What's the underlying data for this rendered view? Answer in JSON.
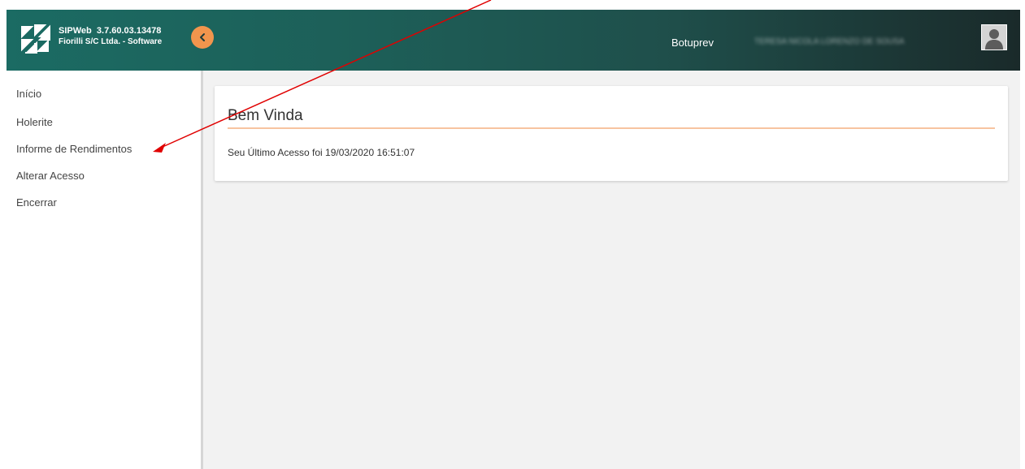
{
  "header": {
    "app_name": "SIPWeb",
    "version": "3.7.60.03.13478",
    "company": "Fiorilli S/C Ltda. - Software",
    "org_name": "Botuprev",
    "user_name_obscured": "TERESA NICOLA LORENZO DE SOUSA",
    "collapse_icon": "chevron-left-icon",
    "logo_icon": "fiorilli-logo-icon",
    "avatar_icon": "user-silhouette-icon",
    "accent_color": "#f2954d",
    "header_color_start": "#1b6b63",
    "header_color_end": "#1a2a2a"
  },
  "sidebar": {
    "items": [
      {
        "label": "Início"
      },
      {
        "label": "Holerite"
      },
      {
        "label": "Informe de Rendimentos"
      },
      {
        "label": "Alterar Acesso"
      },
      {
        "label": "Encerrar"
      }
    ]
  },
  "main": {
    "card_title": "Bem Vinda",
    "last_access": "Seu Último Acesso foi 19/03/2020 16:51:07",
    "rule_color": "#f7c4a0"
  },
  "annotation": {
    "arrow_color": "#e00000",
    "target": "Informe de Rendimentos"
  }
}
